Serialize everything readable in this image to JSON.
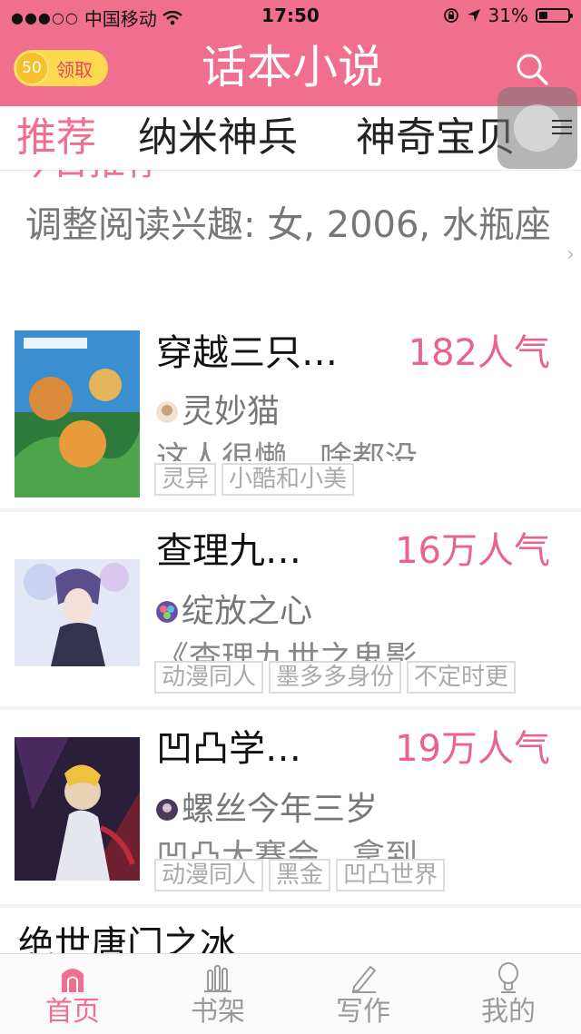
{
  "status_bar": {
    "signal": "●●●○○",
    "carrier": "中国移动",
    "time": "17:50",
    "battery": "31%"
  },
  "header": {
    "coins": "50",
    "claim_label": "领取",
    "title": "话本小说",
    "search_icon": "search-icon"
  },
  "tabs": [
    "推荐",
    "纳米神兵",
    "神奇宝贝"
  ],
  "section": {
    "title": "今日推荐",
    "interest": "调整阅读兴趣: 女, 2006, 水瓶座"
  },
  "books": [
    {
      "title": "穿越三只…",
      "popularity": "182人气",
      "author": "灵妙猫",
      "description": "这人很懒，啥都没",
      "tags": [
        "灵异",
        "小酷和小美"
      ]
    },
    {
      "title": "查理九…",
      "popularity": "16万人气",
      "author": "绽放之心",
      "description": "《查理九世之鬼影",
      "tags": [
        "动漫同人",
        "墨多多身份",
        "不定时更"
      ]
    },
    {
      "title": "凹凸学…",
      "popularity": "19万人气",
      "author": "螺丝今年三岁",
      "description": "凹凸大赛会，拿到",
      "tags": [
        "动漫同人",
        "黑金",
        "凹凸世界"
      ]
    }
  ],
  "partial_book": {
    "title": "绝世唐门之冰"
  },
  "tabbar": [
    {
      "label": "首页",
      "icon": "home-icon"
    },
    {
      "label": "书架",
      "icon": "bookshelf-icon"
    },
    {
      "label": "写作",
      "icon": "pen-icon"
    },
    {
      "label": "我的",
      "icon": "profile-icon"
    }
  ],
  "colors": {
    "brand_pink": "#f06e8e",
    "popularity_pink": "#e9638a",
    "coin_yellow": "#fcd94f"
  }
}
